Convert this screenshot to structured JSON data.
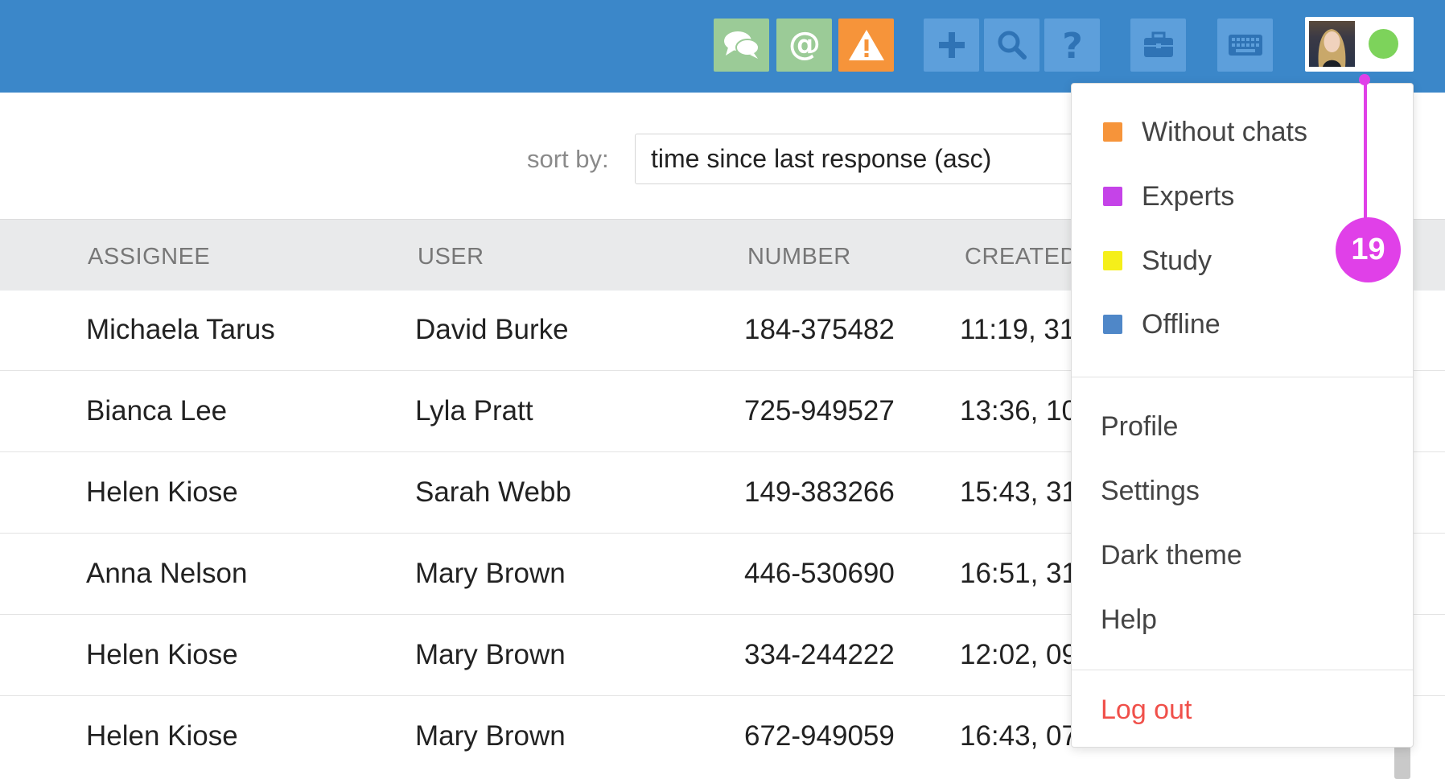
{
  "colors": {
    "topbar": "#3b87c9",
    "chat_green": "#9bcb97",
    "alert_orange": "#f6943a",
    "tool_blue": "#5d9fdb",
    "status_online": "#7dd35b",
    "annotation": "#e040e8",
    "logout_red": "#f0504a"
  },
  "toolbar": {
    "buttons": [
      {
        "icon": "chat-bubbles-icon"
      },
      {
        "icon": "at-mention-icon"
      },
      {
        "icon": "warning-icon"
      },
      {
        "icon": "plus-icon"
      },
      {
        "icon": "search-icon"
      },
      {
        "icon": "help-icon"
      },
      {
        "icon": "briefcase-icon"
      },
      {
        "icon": "keyboard-icon"
      }
    ]
  },
  "sort": {
    "label": "sort by:",
    "value": "time since last response (asc)"
  },
  "table": {
    "headers": {
      "assignee": "ASSIGNEE",
      "user": "USER",
      "number": "NUMBER",
      "created": "CREATED"
    },
    "rows": [
      {
        "assignee": "Michaela Tarus",
        "user": "David Burke",
        "number": "184-375482",
        "created": "11:19, 31"
      },
      {
        "assignee": "Bianca Lee",
        "user": "Lyla Pratt",
        "number": "725-949527",
        "created": "13:36, 10"
      },
      {
        "assignee": "Helen Kiose",
        "user": "Sarah Webb",
        "number": "149-383266",
        "created": "15:43, 31"
      },
      {
        "assignee": "Anna Nelson",
        "user": "Mary Brown",
        "number": "446-530690",
        "created": "16:51, 31"
      },
      {
        "assignee": "Helen Kiose",
        "user": "Mary Brown",
        "number": "334-244222",
        "created": "12:02, 09"
      },
      {
        "assignee": "Helen Kiose",
        "user": "Mary Brown",
        "number": "672-949059",
        "created": "16:43, 07"
      }
    ]
  },
  "menu": {
    "statuses": [
      {
        "label": "Without chats",
        "color": "#f6943a"
      },
      {
        "label": "Experts",
        "color": "#c543e8"
      },
      {
        "label": "Study",
        "color": "#f5ef1a"
      },
      {
        "label": "Offline",
        "color": "#4f87c8"
      }
    ],
    "items": {
      "profile": "Profile",
      "settings": "Settings",
      "dark_theme": "Dark theme",
      "help": "Help",
      "logout": "Log out"
    }
  },
  "annotation": {
    "number": "19"
  }
}
